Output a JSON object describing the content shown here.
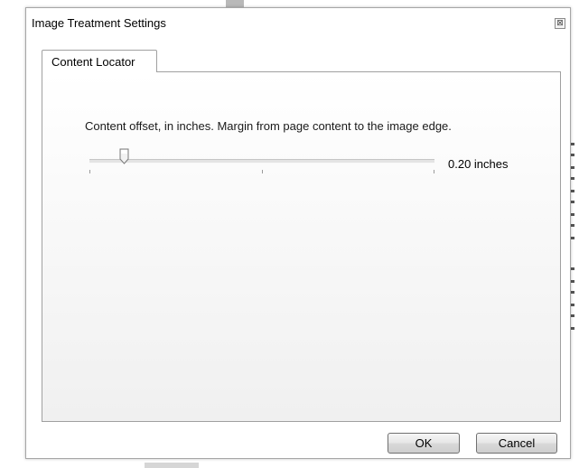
{
  "window": {
    "title": "Image Treatment Settings",
    "close_icon": "close-icon"
  },
  "tabs": [
    {
      "label": "Content Locator",
      "selected": true
    }
  ],
  "content_locator": {
    "description": "Content offset, in inches. Margin from page content to the image edge.",
    "slider": {
      "value_fraction": 0.1,
      "tick_count": 3
    },
    "value_label": "0.20 inches"
  },
  "buttons": {
    "ok_label": "OK",
    "cancel_label": "Cancel"
  }
}
